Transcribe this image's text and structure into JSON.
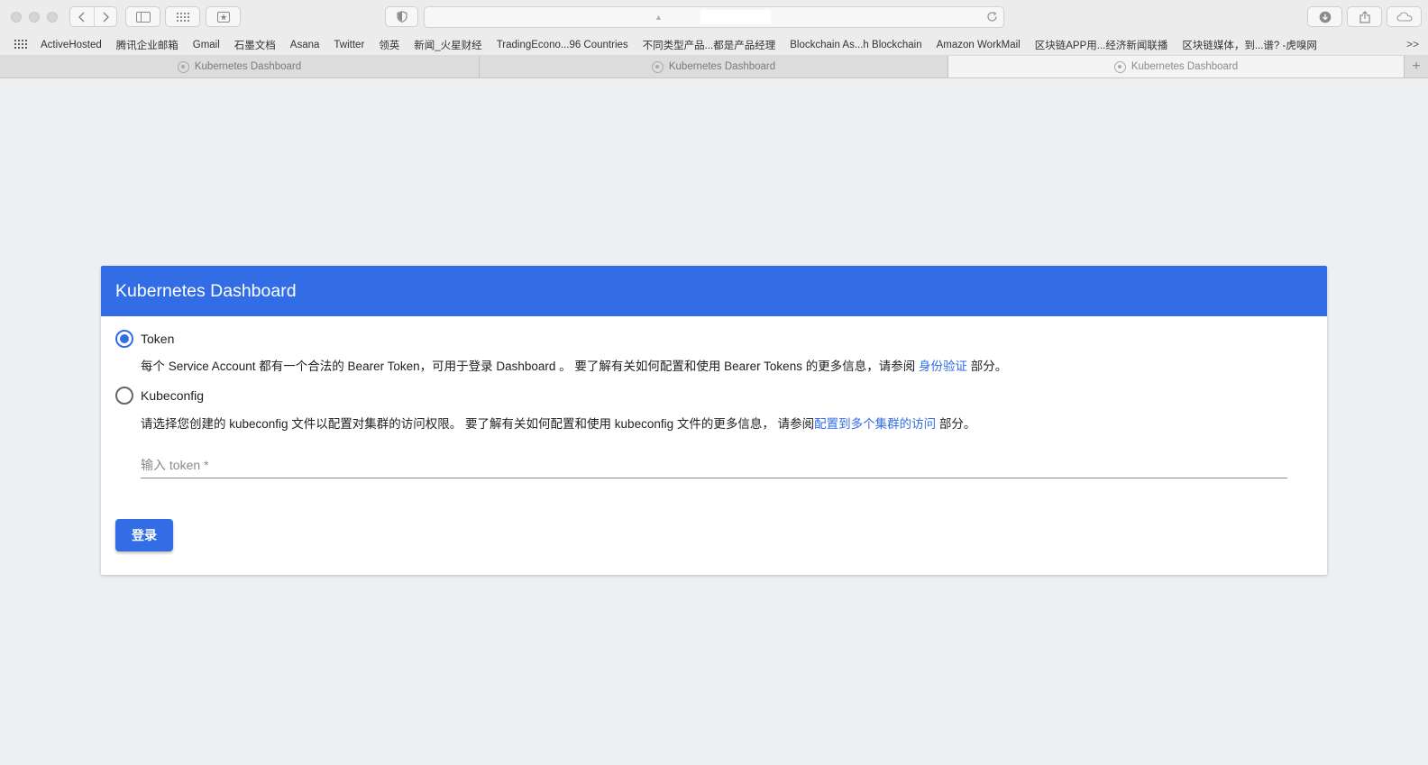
{
  "toolbar": {
    "address_value": ""
  },
  "bookmarks": [
    {
      "label": "ActiveHosted"
    },
    {
      "label": "腾讯企业邮箱"
    },
    {
      "label": "Gmail"
    },
    {
      "label": "石墨文档"
    },
    {
      "label": "Asana"
    },
    {
      "label": "Twitter"
    },
    {
      "label": "领英"
    },
    {
      "label": "新闻_火星财经"
    },
    {
      "label": "TradingEcono...96 Countries"
    },
    {
      "label": "不同类型产品...都是产品经理"
    },
    {
      "label": "Blockchain As...h Blockchain"
    },
    {
      "label": "Amazon WorkMail"
    },
    {
      "label": "区块链APP用...经济新闻联播"
    },
    {
      "label": "区块链媒体，到...谱? -虎嗅网"
    }
  ],
  "bookmarks_more": ">>",
  "tabs": [
    {
      "label": "Kubernetes Dashboard",
      "active": false
    },
    {
      "label": "Kubernetes Dashboard",
      "active": false
    },
    {
      "label": "Kubernetes Dashboard",
      "active": true
    }
  ],
  "tab_add": "+",
  "card": {
    "title": "Kubernetes Dashboard",
    "accent_color": "#326de6",
    "token_option": {
      "label": "Token",
      "selected": true,
      "desc_before": "每个 Service Account 都有一个合法的 Bearer Token，可用于登录 Dashboard 。 要了解有关如何配置和使用 Bearer Tokens 的更多信息，请参阅 ",
      "desc_link": "身份验证",
      "desc_after": " 部分。"
    },
    "kubeconfig_option": {
      "label": "Kubeconfig",
      "selected": false,
      "desc_before": "请选择您创建的 kubeconfig 文件以配置对集群的访问权限。 要了解有关如何配置和使用 kubeconfig 文件的更多信息， 请参阅",
      "desc_link": "配置到多个集群的访问",
      "desc_after": " 部分。"
    },
    "token_input": {
      "placeholder": "输入 token *",
      "value": ""
    },
    "login_button": "登录"
  }
}
